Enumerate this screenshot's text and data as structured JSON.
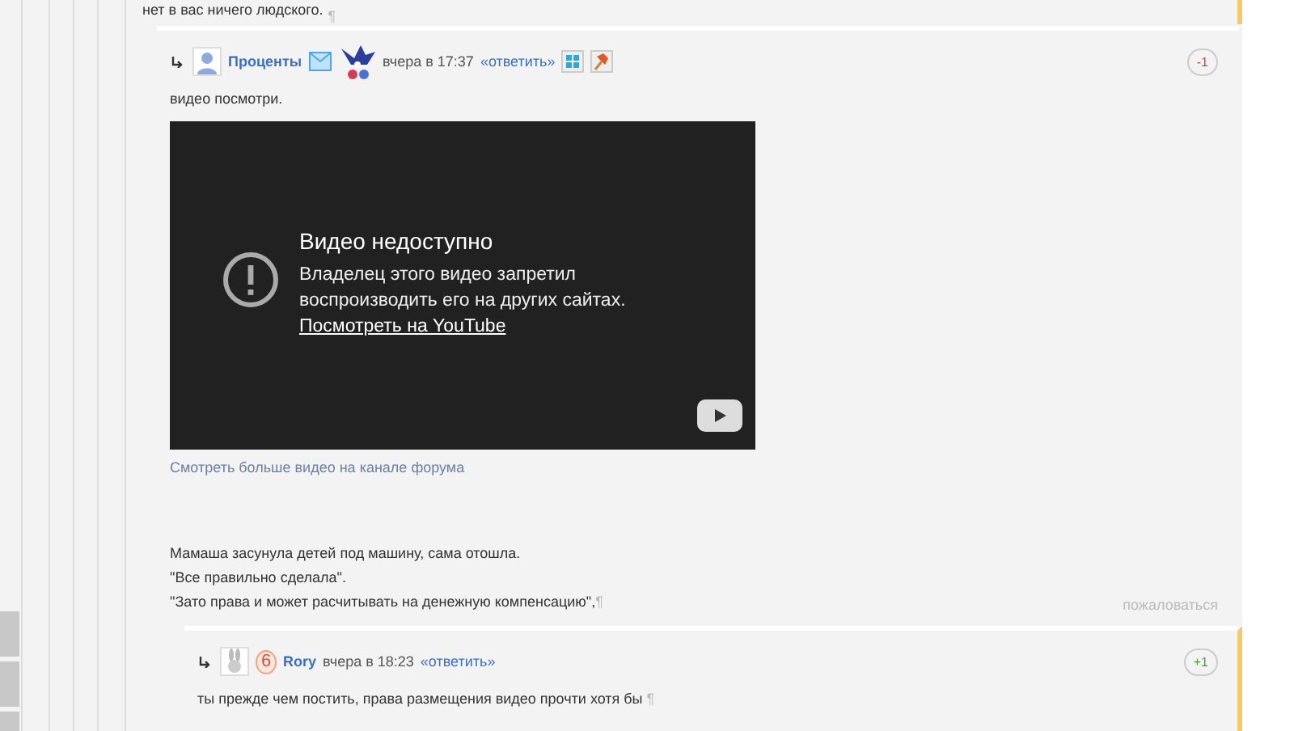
{
  "previous_comment": {
    "text": "нет в вас ничего людского.",
    "pilcrow": "¶",
    "new": true
  },
  "comments": [
    {
      "author": "Проценты",
      "time": "вчера в 17:37",
      "reply": "«ответить»",
      "rating": {
        "text": "-1",
        "color": "#d04040"
      },
      "new": false,
      "lines": [
        "видео посмотри."
      ],
      "video": {
        "title": "Видео недоступно",
        "message": "Владелец этого видео запретил воспроизводить его на других сайтах.",
        "link": "Посмотреть на YouTube"
      },
      "channel_link": "Смотреть больше видео на канале форума",
      "quote_lines": [
        "Мамаша засунула детей под машину, сама отошла.",
        "\"Все правильно сделала\".",
        "\"Зато права и может расчитывать на денежную компенсацию\","
      ],
      "pilcrow": "¶",
      "complaint": "пожаловаться",
      "children": [
        {
          "author": "Rory",
          "badge": "6",
          "time": "вчера в 18:23",
          "reply": "«ответить»",
          "rating": {
            "text": "+1",
            "color": "#4a9e2e"
          },
          "new": true,
          "lines": [
            "ты прежде чем постить, права размещения видео прочти хотя бы"
          ],
          "pilcrow": "¶"
        }
      ]
    }
  ]
}
